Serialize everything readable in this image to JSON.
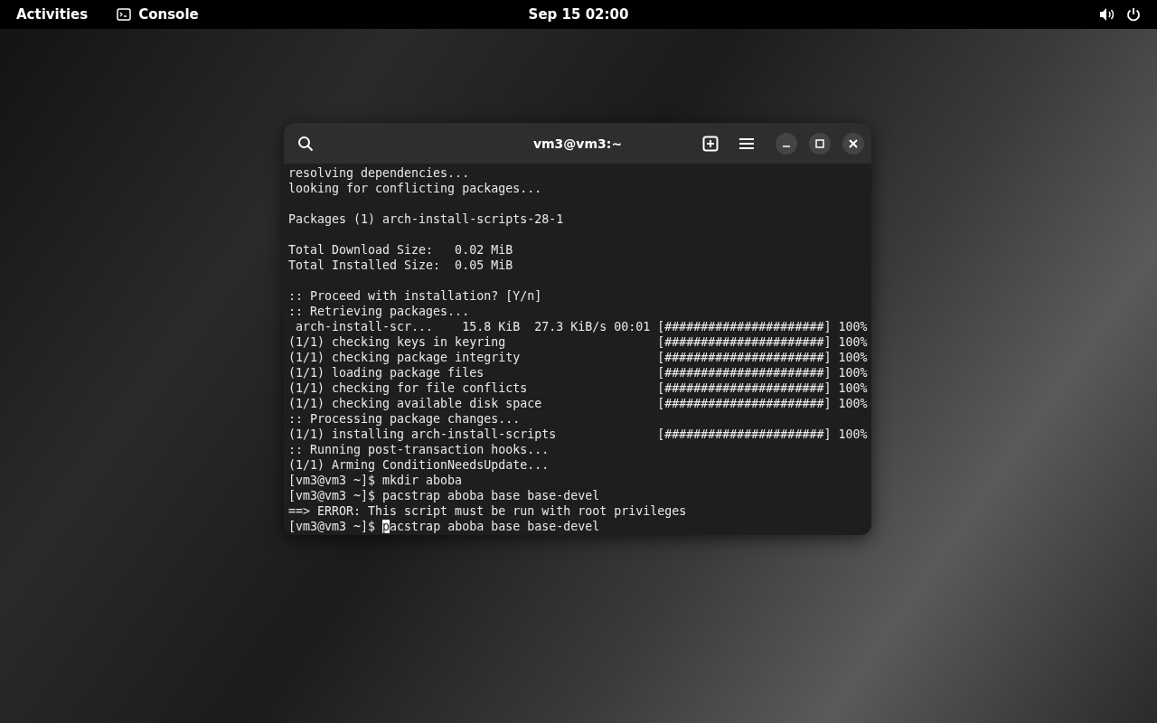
{
  "top_bar": {
    "activities": "Activities",
    "app_name": "Console",
    "clock": "Sep 15  02:00"
  },
  "window": {
    "title": "vm3@vm3:~"
  },
  "terminal": {
    "lines": [
      {
        "kind": "text",
        "text": "resolving dependencies..."
      },
      {
        "kind": "text",
        "text": "looking for conflicting packages..."
      },
      {
        "kind": "blank"
      },
      {
        "kind": "text",
        "text": "Packages (1) arch-install-scripts-28-1"
      },
      {
        "kind": "blank"
      },
      {
        "kind": "text",
        "text": "Total Download Size:   0.02 MiB"
      },
      {
        "kind": "text",
        "text": "Total Installed Size:  0.05 MiB"
      },
      {
        "kind": "blank"
      },
      {
        "kind": "text",
        "text": ":: Proceed with installation? [Y/n]"
      },
      {
        "kind": "text",
        "text": ":: Retrieving packages..."
      },
      {
        "kind": "text",
        "text": " arch-install-scr...    15.8 KiB  27.3 KiB/s 00:01 [######################] 100%"
      },
      {
        "kind": "text",
        "text": "(1/1) checking keys in keyring                     [######################] 100%"
      },
      {
        "kind": "text",
        "text": "(1/1) checking package integrity                   [######################] 100%"
      },
      {
        "kind": "text",
        "text": "(1/1) loading package files                        [######################] 100%"
      },
      {
        "kind": "text",
        "text": "(1/1) checking for file conflicts                  [######################] 100%"
      },
      {
        "kind": "text",
        "text": "(1/1) checking available disk space                [######################] 100%"
      },
      {
        "kind": "text",
        "text": ":: Processing package changes..."
      },
      {
        "kind": "text",
        "text": "(1/1) installing arch-install-scripts              [######################] 100%"
      },
      {
        "kind": "text",
        "text": ":: Running post-transaction hooks..."
      },
      {
        "kind": "text",
        "text": "(1/1) Arming ConditionNeedsUpdate..."
      },
      {
        "kind": "text",
        "text": "[vm3@vm3 ~]$ mkdir aboba"
      },
      {
        "kind": "text",
        "text": "[vm3@vm3 ~]$ pacstrap aboba base base-devel"
      },
      {
        "kind": "text",
        "text": "==> ERROR: This script must be run with root privileges"
      }
    ],
    "prompt": {
      "prompt": "[vm3@vm3 ~]$ ",
      "cursor": "p",
      "rest": "acstrap aboba base base-devel"
    }
  }
}
